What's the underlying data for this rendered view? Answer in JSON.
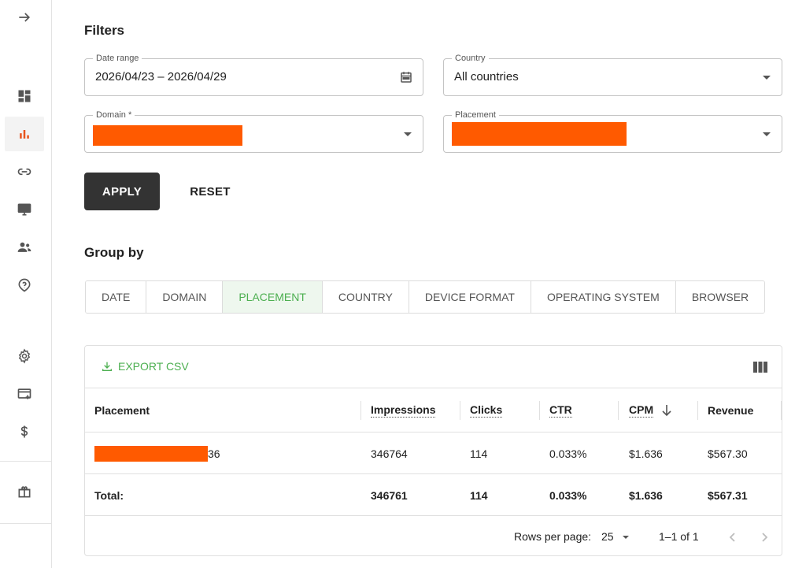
{
  "sidebar": {
    "items": [
      {
        "name": "expand-icon"
      },
      {
        "name": "dashboard-icon"
      },
      {
        "name": "analytics-icon"
      },
      {
        "name": "link-icon"
      },
      {
        "name": "monitor-icon"
      },
      {
        "name": "users-icon"
      },
      {
        "name": "help-icon"
      },
      {
        "name": "settings-icon"
      },
      {
        "name": "billing-icon"
      },
      {
        "name": "dollar-icon"
      },
      {
        "name": "gift-icon"
      }
    ],
    "active_color": "#e8541d"
  },
  "filters": {
    "title": "Filters",
    "date_range": {
      "label": "Date range",
      "value": "2026/04/23 – 2026/04/29"
    },
    "country": {
      "label": "Country",
      "value": "All countries"
    },
    "domain": {
      "label": "Domain *"
    },
    "placement": {
      "label": "Placement"
    },
    "apply_label": "APPLY",
    "reset_label": "RESET"
  },
  "groupby": {
    "title": "Group by",
    "options": [
      "DATE",
      "DOMAIN",
      "PLACEMENT",
      "COUNTRY",
      "DEVICE FORMAT",
      "OPERATING SYSTEM",
      "BROWSER"
    ],
    "selected": "PLACEMENT"
  },
  "table": {
    "export_label": "EXPORT CSV",
    "headers": {
      "placement": "Placement",
      "impressions": "Impressions",
      "clicks": "Clicks",
      "ctr": "CTR",
      "cpm": "CPM",
      "revenue": "Revenue"
    },
    "rows": [
      {
        "placement_suffix": "36",
        "impressions": "346764",
        "clicks": "114",
        "ctr": "0.033%",
        "cpm": "$1.636",
        "revenue": "$567.30"
      }
    ],
    "total": {
      "label": "Total:",
      "impressions": "346761",
      "clicks": "114",
      "ctr": "0.033%",
      "cpm": "$1.636",
      "revenue": "$567.31"
    },
    "footer": {
      "rows_per_page_label": "Rows per page:",
      "rows_per_page": "25",
      "range": "1–1 of 1"
    }
  },
  "colors": {
    "accent_green": "#4caf50",
    "redaction": "#ff5a00",
    "apply_bg": "#333333"
  }
}
